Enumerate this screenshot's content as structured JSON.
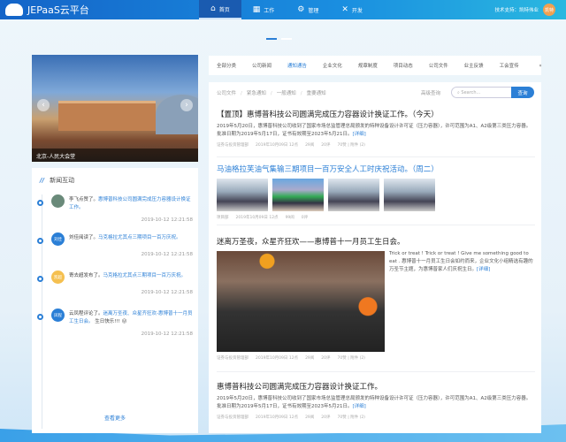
{
  "header": {
    "app_title": "JEPaaS云平台",
    "nav": [
      {
        "label": "首页",
        "icon": "home-icon"
      },
      {
        "label": "工作",
        "icon": "grid-icon"
      },
      {
        "label": "管理",
        "icon": "gear-icon"
      },
      {
        "label": "开发",
        "icon": "tools-icon"
      }
    ],
    "support": "技术支持：凯特伟业",
    "avatar": "凯特"
  },
  "carousel": {
    "caption": "北京-人民大会堂"
  },
  "news": {
    "title": "新闻互动",
    "more": "查看更多",
    "items": [
      {
        "avatar": "",
        "actor": "李飞点赞了。",
        "link": "惠博普科技公司圆满完成压力容器设计换证工作。",
        "extra": "",
        "time": "2019-10-12 12:21:58",
        "color": "#6a8a7a"
      },
      {
        "avatar": "刘佳",
        "actor": "刘佳阅读了。",
        "link": "马克格拉尤其点三期项目一百万庆祝。",
        "extra": "",
        "time": "2019-10-12 12:21:58",
        "color": "#2b7fd6"
      },
      {
        "avatar": "凯超",
        "actor": "寄去超发布了。",
        "link": "马克格拉尤其点三期项目一百万庆祝。",
        "extra": "",
        "time": "2019-10-12 12:21:58",
        "color": "#f5c050"
      },
      {
        "avatar": "凤程",
        "actor": "云凤程评论了。",
        "link": "迷离万圣夜、众星齐狂欢-惠博普十一月员工生日会。",
        "extra": "生日快乐!!! 😜",
        "time": "2019-10-12 12:21:58",
        "color": "#2b7fd6"
      }
    ]
  },
  "categories": [
    "全部分类",
    "公司新闻",
    "通知通告",
    "企业文化",
    "规章制度",
    "项目动态",
    "公司文件",
    "业主反馈",
    "工会宣传"
  ],
  "main": {
    "crumbs": [
      "公司文件",
      "紧急通知",
      "一般通知",
      "重要通知"
    ],
    "advanced": "高级查询",
    "search_placeholder": "Search...",
    "search_btn": "查询",
    "articles": [
      {
        "title": "【置顶】惠博普科技公司圆满完成压力容器设计换证工作。（今天）",
        "body": "2019年5月20日，惠博普科技公司收到了国家市场总监管理总局颁发的特种设备设计许可证（压力容器），许可范围为A1、A2级第三类压力容器。批准日期为2019年5月17日，证书有效期至2023年5月21日。",
        "more": "[详细]",
        "meta": [
          "证券与投资管理部",
          "2019年10月09日 12点",
          "29阅",
          "20评",
          "70赞 | 附件 (2)"
        ]
      },
      {
        "title": "马油格拉芙油气集输三期项目一百万安全人工时庆祝活动。（周二）",
        "meta": [
          "项目部",
          "2019年10月09日 12点",
          "99阅",
          "0评"
        ]
      },
      {
        "title": "迷离万圣夜，众星齐狂欢——惠博普十一月员工生日会。",
        "body": "Trick or treat ! Trick or treat ! Give me something good to eat . 惠博普十一月员工生日会如约而来，企业文化小组精选有趣的万圣节主题，为惠博普家人们庆祝生日。",
        "more": "[详细]",
        "meta": [
          "证券与投资管理部",
          "2019年10月09日 12点",
          "29阅",
          "20评",
          "70赞 | 附件 (2)"
        ]
      },
      {
        "title": "惠博普科技公司圆满完成压力容器设计换证工作。",
        "body": "2019年5月20日，惠博普科技公司收到了国家市场总监管理总局颁发的特种设备设计许可证（压力容器），许可范围为A1、A2级第三类压力容器。批准日期为2019年5月17日，证书有效期至2023年5月21日。",
        "more": "[详细]",
        "meta": [
          "证券与投资管理部",
          "2019年10月09日 12点",
          "29阅",
          "20评",
          "70赞 | 附件 (2)"
        ]
      }
    ]
  }
}
